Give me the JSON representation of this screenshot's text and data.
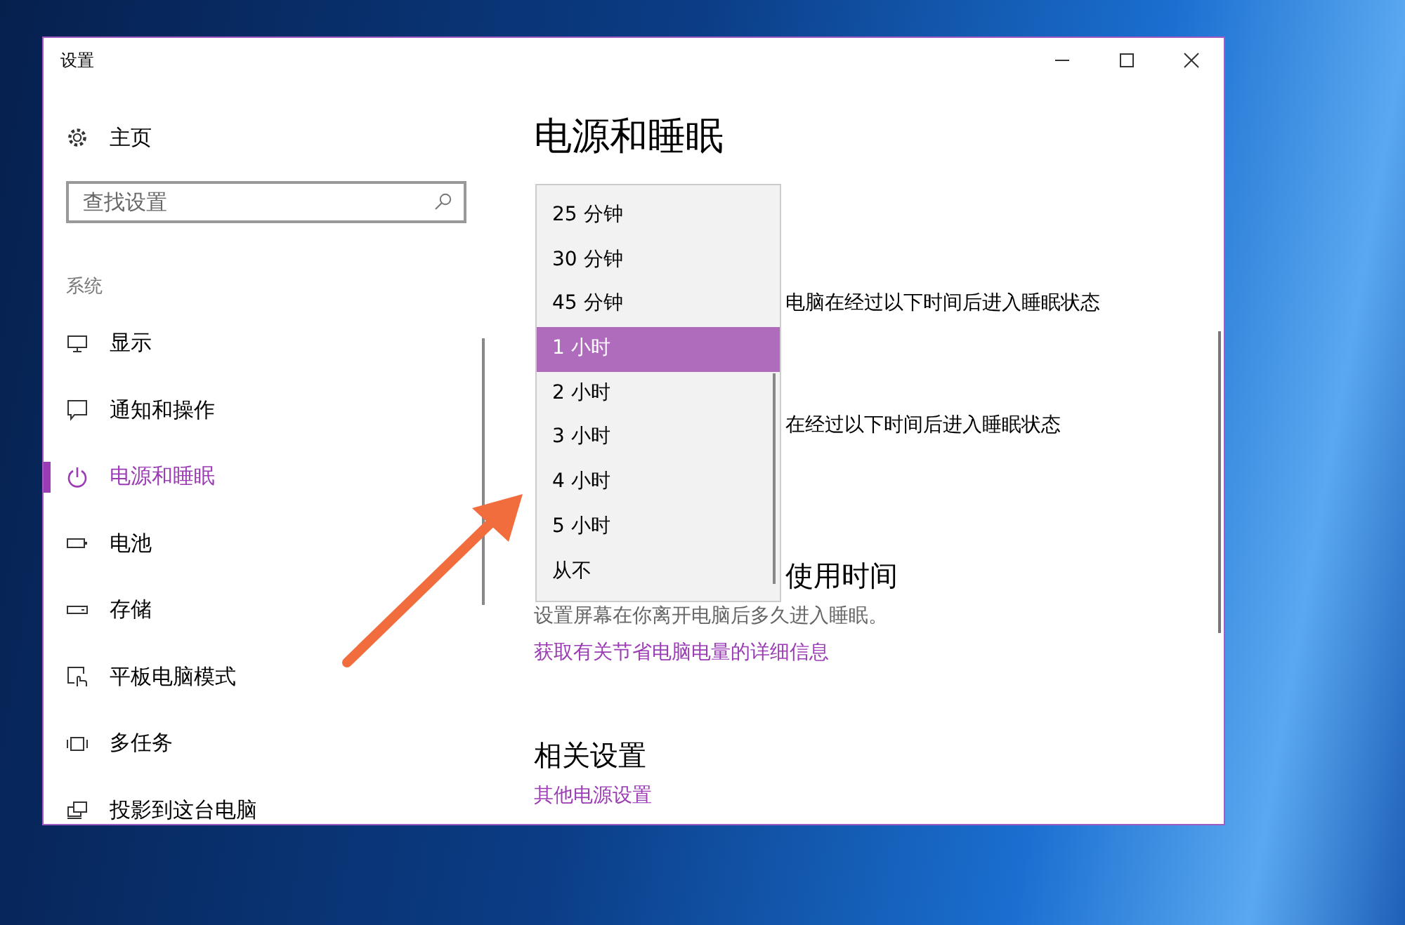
{
  "window": {
    "title": "设置"
  },
  "sidebar": {
    "home": "主页",
    "search": {
      "placeholder": "查找设置"
    },
    "section": "系统",
    "items": [
      {
        "label": "显示",
        "selected": false
      },
      {
        "label": "通知和操作",
        "selected": false
      },
      {
        "label": "电源和睡眠",
        "selected": true
      },
      {
        "label": "电池",
        "selected": false
      },
      {
        "label": "存储",
        "selected": false
      },
      {
        "label": "平板电脑模式",
        "selected": false
      },
      {
        "label": "多任务",
        "selected": false
      },
      {
        "label": "投影到这台电脑",
        "selected": false
      }
    ]
  },
  "content": {
    "title": "电源和睡眠",
    "partial_texts": [
      "电脑在经过以下时间后进入睡眠状态",
      "在经过以下时间后进入睡眠状态"
    ],
    "heading_partial": "使用时间",
    "description": "设置屏幕在你离开电脑后多久进入睡眠。",
    "link": "获取有关节省电脑电量的详细信息",
    "related_heading": "相关设置",
    "related_link": "其他电源设置",
    "dropdown": {
      "options": [
        {
          "label": "25 分钟",
          "selected": false
        },
        {
          "label": "30 分钟",
          "selected": false
        },
        {
          "label": "45 分钟",
          "selected": false
        },
        {
          "label": "1 小时",
          "selected": true
        },
        {
          "label": "2 小时",
          "selected": false
        },
        {
          "label": "3 小时",
          "selected": false
        },
        {
          "label": "4 小时",
          "selected": false
        },
        {
          "label": "5 小时",
          "selected": false
        },
        {
          "label": "从不",
          "selected": false
        }
      ]
    }
  }
}
